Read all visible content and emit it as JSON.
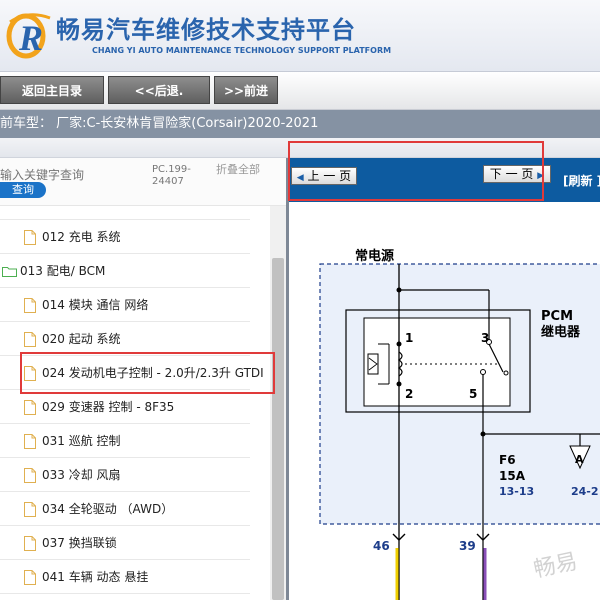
{
  "header": {
    "title_cn": "畅易汽车维修技术支持平台",
    "title_en": "CHANG YI AUTO MAINTENANCE TECHNOLOGY SUPPORT PLATFORM"
  },
  "nav": {
    "home": "返回主目录",
    "back": "<<后退.",
    "forward": ">>前进"
  },
  "vehicle": {
    "text": "前车型： 厂家:C-长安林肯冒险家(Corsair)2020-2021"
  },
  "search": {
    "placeholder": "输入关键字查询",
    "button": "查询",
    "pc_info": "PC.199-24407",
    "collapse": "折叠全部"
  },
  "tree": {
    "items": [
      {
        "label": "012 充电 系统",
        "type": "doc"
      },
      {
        "label": "013 配电/ BCM",
        "type": "folder"
      },
      {
        "label": "014 模块 通信 网络",
        "type": "doc"
      },
      {
        "label": "020 起动 系统",
        "type": "doc"
      },
      {
        "label": "024 发动机电子控制 - 2.0升/2.3升 GTDI",
        "type": "doc"
      },
      {
        "label": "029 变速器 控制 - 8F35",
        "type": "doc"
      },
      {
        "label": "031 巡航 控制",
        "type": "doc"
      },
      {
        "label": "033 冷却 风扇",
        "type": "doc"
      },
      {
        "label": "034 全轮驱动 （AWD）",
        "type": "doc"
      },
      {
        "label": "037 换挡联锁",
        "type": "doc"
      },
      {
        "label": "041 车辆 动态 悬挂",
        "type": "doc"
      }
    ]
  },
  "pager": {
    "prev": "上 一 页",
    "next": "下 一 页",
    "refresh": "[刷新 ]"
  },
  "diagram": {
    "power_label": "常电源",
    "relay_name_1": "PCM",
    "relay_name_2": "继电器",
    "pin1": "1",
    "pin2": "2",
    "pin3": "3",
    "pin5": "5",
    "fuse_name": "F6",
    "fuse_rating": "15A",
    "fuse_ref": "13-13",
    "ref2": "24-2",
    "wire46": "46",
    "wire39": "39",
    "watermark": "畅易"
  },
  "colors": {
    "brand_blue": "#2a64ad",
    "pager_blue": "#0d5ba0",
    "highlight_red": "#e03a3a",
    "wire_yellow": "#f0d000",
    "wire_purple": "#8a4fb8"
  }
}
